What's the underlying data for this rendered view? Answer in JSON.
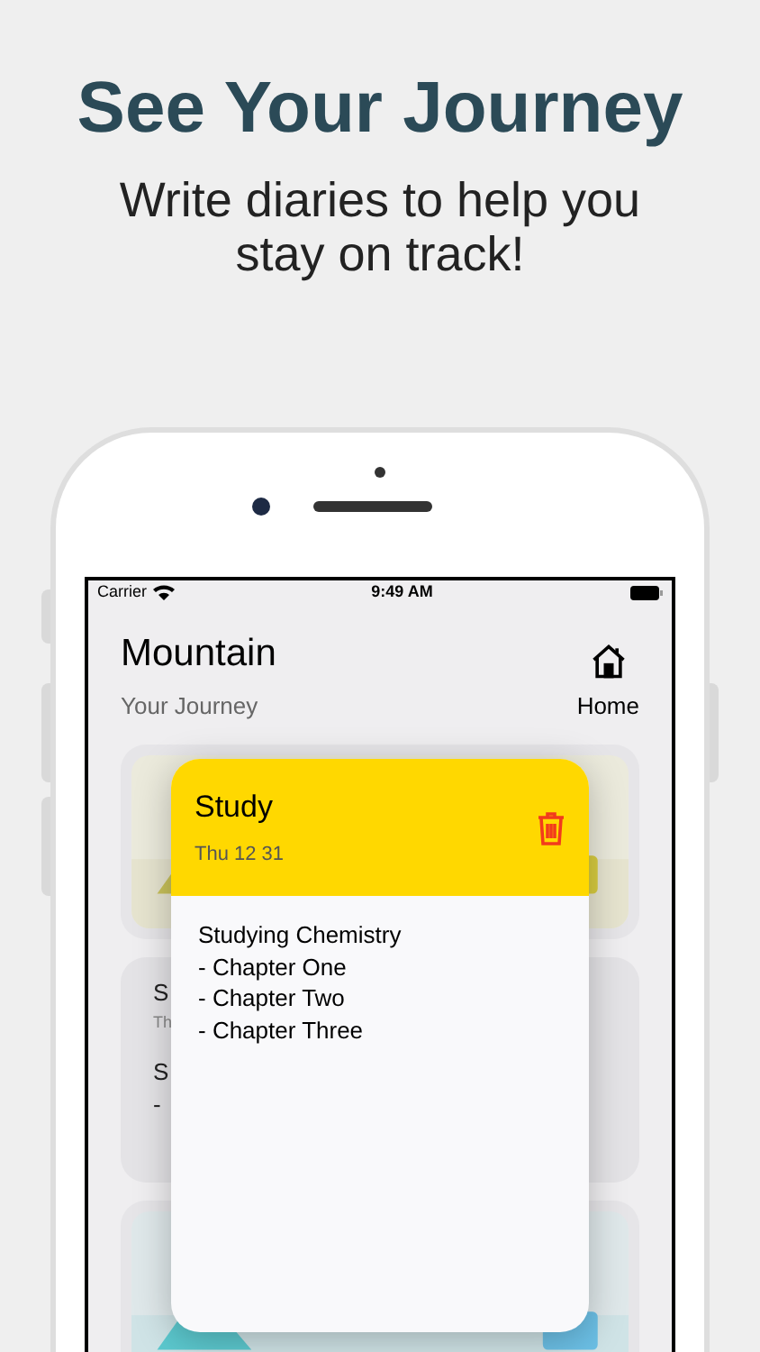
{
  "headline": "See Your Journey",
  "subtitle": "Write diaries to help you stay on track!",
  "status_bar": {
    "carrier": "Carrier",
    "time": "9:49 AM"
  },
  "header": {
    "title": "Mountain",
    "subtitle": "Your Journey",
    "home_label": "Home"
  },
  "background_cards": [
    {
      "kind": "picture"
    },
    {
      "kind": "text",
      "fragments": [
        "S",
        "Th",
        "S",
        "-"
      ]
    },
    {
      "kind": "picture"
    }
  ],
  "entry": {
    "title": "Study",
    "date": "Thu 12 31",
    "lines": [
      "Studying Chemistry",
      "- Chapter One",
      "- Chapter Two",
      "- Chapter Three"
    ]
  }
}
